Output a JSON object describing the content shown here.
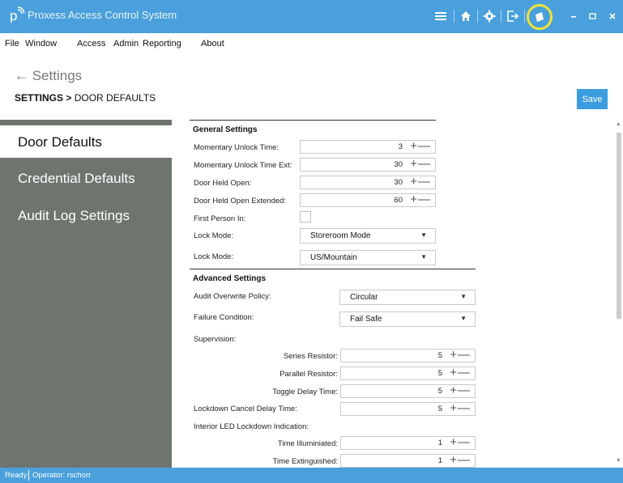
{
  "window": {
    "title": "Proxess Access Control System"
  },
  "menu": [
    "File",
    "Window",
    "Access",
    "Admin",
    "Reporting",
    "About"
  ],
  "page": {
    "back_label": "← Settings",
    "breadcrumb_root": "SETTINGS",
    "breadcrumb_sep": ">",
    "breadcrumb_current": "DOOR DEFAULTS",
    "save_label": "Save"
  },
  "sidebar": {
    "items": [
      {
        "label": "Door Defaults",
        "active": true
      },
      {
        "label": "Credential Defaults",
        "active": false
      },
      {
        "label": "Audit Log Settings",
        "active": false
      }
    ]
  },
  "general": {
    "title": "General Settings",
    "momentary_unlock": {
      "label": "Momentary Unlock Time:",
      "value": "3"
    },
    "momentary_unlock_ext": {
      "label": "Momentary Unlock Time Ext:",
      "value": "30"
    },
    "door_held_open": {
      "label": "Door Held Open:",
      "value": "30"
    },
    "door_held_open_ext": {
      "label": "Door Held Open Extended:",
      "value": "60"
    },
    "first_person_in": {
      "label": "First Person In:"
    },
    "lock_mode_1": {
      "label": "Lock Mode:",
      "value": "Storeroom Mode"
    },
    "lock_mode_2": {
      "label": "Lock Mode:",
      "value": "US/Mountain"
    }
  },
  "advanced": {
    "title": "Advanced Settings",
    "audit_overwrite": {
      "label": "Audit Overwrite Policy:",
      "value": "Circular"
    },
    "failure_condition": {
      "label": "Failure Condition:",
      "value": "Fail Safe"
    },
    "supervision_label": "Supervision:",
    "series_resistor": {
      "label": "Series Resistor:",
      "value": "5"
    },
    "parallel_resistor": {
      "label": "Parallel Resistor:",
      "value": "5"
    },
    "toggle_delay": {
      "label": "Toggle Delay Time:",
      "value": "5"
    },
    "lockdown_cancel": {
      "label": "Lockdown Cancel Delay Time:",
      "value": "5"
    },
    "interior_led_label": "Interior LED Lockdown Indication:",
    "time_illuminated": {
      "label": "Time Illuminiated:",
      "value": "1"
    },
    "time_extinguished": {
      "label": "Time Extinguished:",
      "value": "1"
    }
  },
  "status": {
    "ready": "Ready",
    "operator": "Operator: rschorr"
  },
  "symbols": {
    "plus": "+",
    "minus": "—",
    "arrow": "▼"
  },
  "colors": {
    "titlebar": "#4aa0dc",
    "sidebar": "#6e756f",
    "save_button": "#3a9de0",
    "highlight": "#f1e23a"
  }
}
